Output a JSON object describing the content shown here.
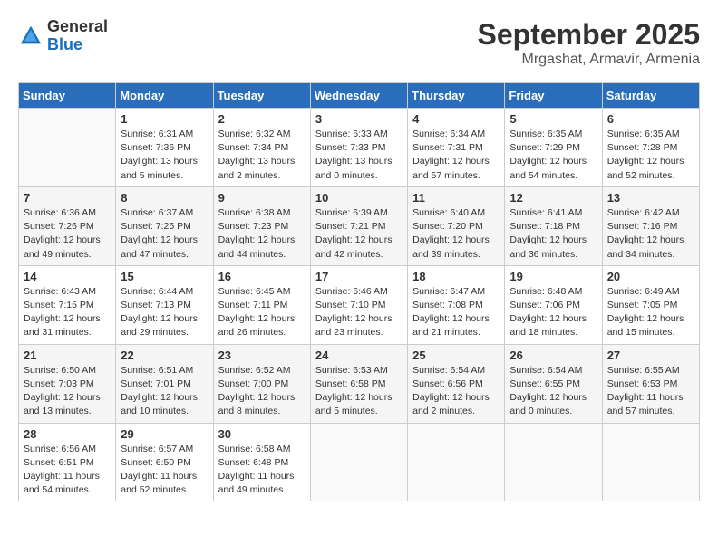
{
  "header": {
    "logo_general": "General",
    "logo_blue": "Blue",
    "month_title": "September 2025",
    "location": "Mrgashat, Armavir, Armenia"
  },
  "days_of_week": [
    "Sunday",
    "Monday",
    "Tuesday",
    "Wednesday",
    "Thursday",
    "Friday",
    "Saturday"
  ],
  "weeks": [
    [
      {
        "day": "",
        "empty": true
      },
      {
        "day": "1",
        "sunrise": "Sunrise: 6:31 AM",
        "sunset": "Sunset: 7:36 PM",
        "daylight": "Daylight: 13 hours and 5 minutes."
      },
      {
        "day": "2",
        "sunrise": "Sunrise: 6:32 AM",
        "sunset": "Sunset: 7:34 PM",
        "daylight": "Daylight: 13 hours and 2 minutes."
      },
      {
        "day": "3",
        "sunrise": "Sunrise: 6:33 AM",
        "sunset": "Sunset: 7:33 PM",
        "daylight": "Daylight: 13 hours and 0 minutes."
      },
      {
        "day": "4",
        "sunrise": "Sunrise: 6:34 AM",
        "sunset": "Sunset: 7:31 PM",
        "daylight": "Daylight: 12 hours and 57 minutes."
      },
      {
        "day": "5",
        "sunrise": "Sunrise: 6:35 AM",
        "sunset": "Sunset: 7:29 PM",
        "daylight": "Daylight: 12 hours and 54 minutes."
      },
      {
        "day": "6",
        "sunrise": "Sunrise: 6:35 AM",
        "sunset": "Sunset: 7:28 PM",
        "daylight": "Daylight: 12 hours and 52 minutes."
      }
    ],
    [
      {
        "day": "7",
        "sunrise": "Sunrise: 6:36 AM",
        "sunset": "Sunset: 7:26 PM",
        "daylight": "Daylight: 12 hours and 49 minutes."
      },
      {
        "day": "8",
        "sunrise": "Sunrise: 6:37 AM",
        "sunset": "Sunset: 7:25 PM",
        "daylight": "Daylight: 12 hours and 47 minutes."
      },
      {
        "day": "9",
        "sunrise": "Sunrise: 6:38 AM",
        "sunset": "Sunset: 7:23 PM",
        "daylight": "Daylight: 12 hours and 44 minutes."
      },
      {
        "day": "10",
        "sunrise": "Sunrise: 6:39 AM",
        "sunset": "Sunset: 7:21 PM",
        "daylight": "Daylight: 12 hours and 42 minutes."
      },
      {
        "day": "11",
        "sunrise": "Sunrise: 6:40 AM",
        "sunset": "Sunset: 7:20 PM",
        "daylight": "Daylight: 12 hours and 39 minutes."
      },
      {
        "day": "12",
        "sunrise": "Sunrise: 6:41 AM",
        "sunset": "Sunset: 7:18 PM",
        "daylight": "Daylight: 12 hours and 36 minutes."
      },
      {
        "day": "13",
        "sunrise": "Sunrise: 6:42 AM",
        "sunset": "Sunset: 7:16 PM",
        "daylight": "Daylight: 12 hours and 34 minutes."
      }
    ],
    [
      {
        "day": "14",
        "sunrise": "Sunrise: 6:43 AM",
        "sunset": "Sunset: 7:15 PM",
        "daylight": "Daylight: 12 hours and 31 minutes."
      },
      {
        "day": "15",
        "sunrise": "Sunrise: 6:44 AM",
        "sunset": "Sunset: 7:13 PM",
        "daylight": "Daylight: 12 hours and 29 minutes."
      },
      {
        "day": "16",
        "sunrise": "Sunrise: 6:45 AM",
        "sunset": "Sunset: 7:11 PM",
        "daylight": "Daylight: 12 hours and 26 minutes."
      },
      {
        "day": "17",
        "sunrise": "Sunrise: 6:46 AM",
        "sunset": "Sunset: 7:10 PM",
        "daylight": "Daylight: 12 hours and 23 minutes."
      },
      {
        "day": "18",
        "sunrise": "Sunrise: 6:47 AM",
        "sunset": "Sunset: 7:08 PM",
        "daylight": "Daylight: 12 hours and 21 minutes."
      },
      {
        "day": "19",
        "sunrise": "Sunrise: 6:48 AM",
        "sunset": "Sunset: 7:06 PM",
        "daylight": "Daylight: 12 hours and 18 minutes."
      },
      {
        "day": "20",
        "sunrise": "Sunrise: 6:49 AM",
        "sunset": "Sunset: 7:05 PM",
        "daylight": "Daylight: 12 hours and 15 minutes."
      }
    ],
    [
      {
        "day": "21",
        "sunrise": "Sunrise: 6:50 AM",
        "sunset": "Sunset: 7:03 PM",
        "daylight": "Daylight: 12 hours and 13 minutes."
      },
      {
        "day": "22",
        "sunrise": "Sunrise: 6:51 AM",
        "sunset": "Sunset: 7:01 PM",
        "daylight": "Daylight: 12 hours and 10 minutes."
      },
      {
        "day": "23",
        "sunrise": "Sunrise: 6:52 AM",
        "sunset": "Sunset: 7:00 PM",
        "daylight": "Daylight: 12 hours and 8 minutes."
      },
      {
        "day": "24",
        "sunrise": "Sunrise: 6:53 AM",
        "sunset": "Sunset: 6:58 PM",
        "daylight": "Daylight: 12 hours and 5 minutes."
      },
      {
        "day": "25",
        "sunrise": "Sunrise: 6:54 AM",
        "sunset": "Sunset: 6:56 PM",
        "daylight": "Daylight: 12 hours and 2 minutes."
      },
      {
        "day": "26",
        "sunrise": "Sunrise: 6:54 AM",
        "sunset": "Sunset: 6:55 PM",
        "daylight": "Daylight: 12 hours and 0 minutes."
      },
      {
        "day": "27",
        "sunrise": "Sunrise: 6:55 AM",
        "sunset": "Sunset: 6:53 PM",
        "daylight": "Daylight: 11 hours and 57 minutes."
      }
    ],
    [
      {
        "day": "28",
        "sunrise": "Sunrise: 6:56 AM",
        "sunset": "Sunset: 6:51 PM",
        "daylight": "Daylight: 11 hours and 54 minutes."
      },
      {
        "day": "29",
        "sunrise": "Sunrise: 6:57 AM",
        "sunset": "Sunset: 6:50 PM",
        "daylight": "Daylight: 11 hours and 52 minutes."
      },
      {
        "day": "30",
        "sunrise": "Sunrise: 6:58 AM",
        "sunset": "Sunset: 6:48 PM",
        "daylight": "Daylight: 11 hours and 49 minutes."
      },
      {
        "day": "",
        "empty": true
      },
      {
        "day": "",
        "empty": true
      },
      {
        "day": "",
        "empty": true
      },
      {
        "day": "",
        "empty": true
      }
    ]
  ]
}
